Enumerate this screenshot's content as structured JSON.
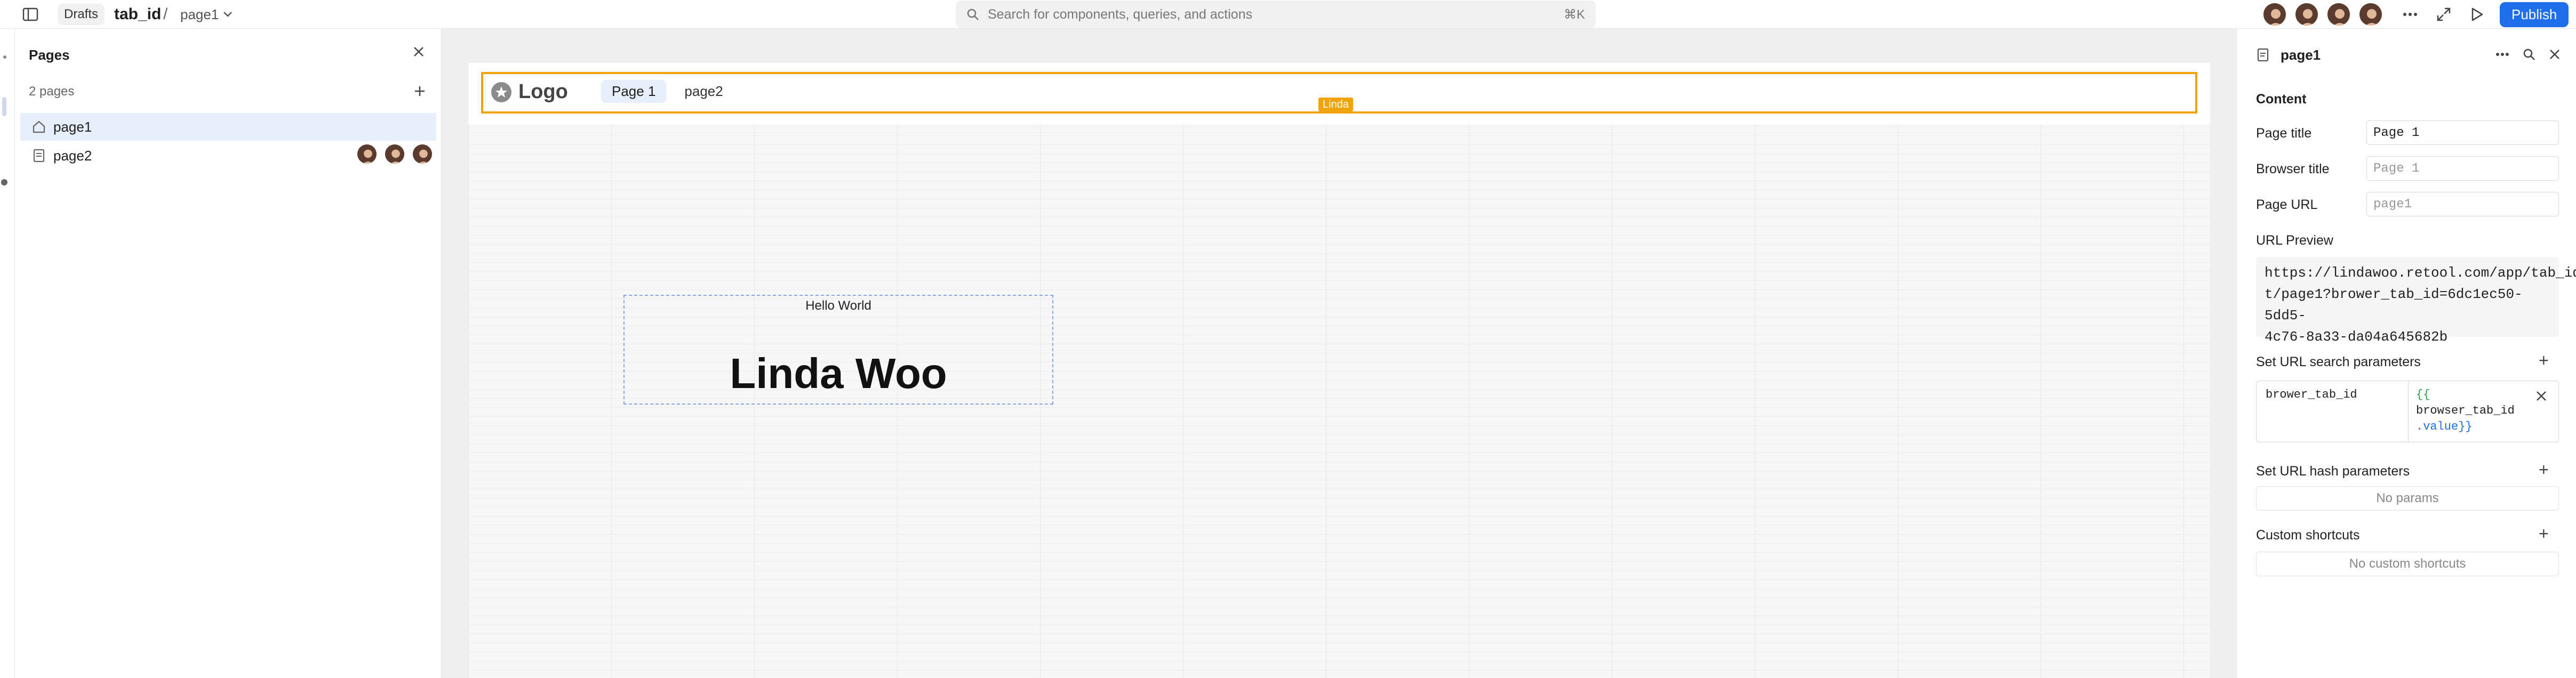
{
  "topbar": {
    "drafts": "Drafts",
    "app_name": "tab_id",
    "separator": "/",
    "current_page": "page1",
    "search_placeholder": "Search for components, queries, and actions",
    "search_shortcut": "⌘K",
    "publish": "Publish"
  },
  "pages_panel": {
    "title": "Pages",
    "count": "2 pages",
    "pages": [
      {
        "name": "page1",
        "icon": "home-icon",
        "selected": true
      },
      {
        "name": "page2",
        "icon": "page-icon",
        "selected": false
      }
    ]
  },
  "canvas": {
    "logo": "Logo",
    "nav": [
      "Page 1",
      "page2"
    ],
    "selection_tag": "Linda",
    "hello_text": "Hello World",
    "name_text": "Linda Woo"
  },
  "inspector": {
    "title": "page1",
    "section_content": "Content",
    "page_title_label": "Page title",
    "page_title_value": "Page 1",
    "browser_title_label": "Browser title",
    "browser_title_placeholder": "Page 1",
    "page_url_label": "Page URL",
    "page_url_placeholder": "page1",
    "url_preview_label": "URL Preview",
    "url_preview_lines": [
      "https://lindawoo.retool.com/app/tab_id_tes",
      "t/page1?brower_tab_id=6dc1ec50-5dd5-",
      "4c76-8a33-da04a645682b"
    ],
    "search_params_label": "Set URL search parameters",
    "param_key": "brower_tab_id",
    "param_value_lines": [
      "{{",
      "browser_tab_id",
      ".value}}"
    ],
    "hash_params_label": "Set URL hash parameters",
    "hash_params_empty": "No params",
    "shortcuts_label": "Custom shortcuts",
    "shortcuts_empty": "No custom shortcuts"
  },
  "colors": {
    "accent": "#1f6feb",
    "selection_orange": "#f0a30a",
    "selected_row": "#e7eefc"
  }
}
